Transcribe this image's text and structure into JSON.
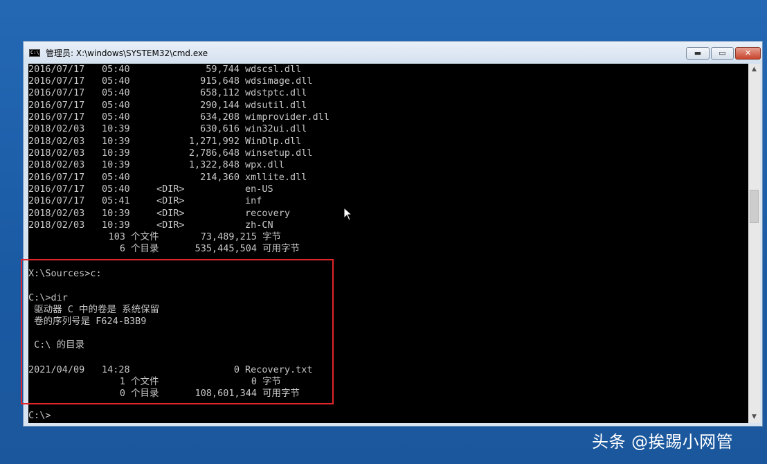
{
  "window": {
    "title": "管理员: X:\\windows\\SYSTEM32\\cmd.exe",
    "icon_label": "C:\\",
    "min_symbol": "▬",
    "max_symbol": "▭",
    "close_symbol": "✕"
  },
  "listing": [
    {
      "date": "2016/07/17",
      "time": "05:40",
      "size": "59,744",
      "name": "wdscsl.dll"
    },
    {
      "date": "2016/07/17",
      "time": "05:40",
      "size": "915,648",
      "name": "wdsimage.dll"
    },
    {
      "date": "2016/07/17",
      "time": "05:40",
      "size": "658,112",
      "name": "wdstptc.dll"
    },
    {
      "date": "2016/07/17",
      "time": "05:40",
      "size": "290,144",
      "name": "wdsutil.dll"
    },
    {
      "date": "2016/07/17",
      "time": "05:40",
      "size": "634,208",
      "name": "wimprovider.dll"
    },
    {
      "date": "2018/02/03",
      "time": "10:39",
      "size": "630,616",
      "name": "win32ui.dll"
    },
    {
      "date": "2018/02/03",
      "time": "10:39",
      "size": "1,271,992",
      "name": "WinDlp.dll"
    },
    {
      "date": "2018/02/03",
      "time": "10:39",
      "size": "2,786,648",
      "name": "winsetup.dll"
    },
    {
      "date": "2018/02/03",
      "time": "10:39",
      "size": "1,322,848",
      "name": "wpx.dll"
    },
    {
      "date": "2016/07/17",
      "time": "05:40",
      "size": "214,360",
      "name": "xmllite.dll"
    },
    {
      "date": "2016/07/17",
      "time": "05:40",
      "dir": "<DIR>",
      "name": "en-US"
    },
    {
      "date": "2016/07/17",
      "time": "05:41",
      "dir": "<DIR>",
      "name": "inf"
    },
    {
      "date": "2018/02/03",
      "time": "10:39",
      "dir": "<DIR>",
      "name": "recovery"
    },
    {
      "date": "2018/02/03",
      "time": "10:39",
      "dir": "<DIR>",
      "name": "zh-CN"
    }
  ],
  "summary1": {
    "files_count": "103",
    "files_label": "个文件",
    "files_bytes": "73,489,215",
    "bytes_label": "字节",
    "dirs_count": "6",
    "dirs_label": "个目录",
    "dirs_free": "535,445,504",
    "free_label": "可用字节"
  },
  "commands": {
    "prompt1": "X:\\Sources>c:",
    "prompt2": "C:\\>dir",
    "volume_line": " 驱动器 C 中的卷是 系统保留",
    "serial_line": " 卷的序列号是 F624-B3B9",
    "dir_of_line": " C:\\ 的目录",
    "prompt3": "C:\\>"
  },
  "file_entry": {
    "date": "2021/04/09",
    "time": "14:28",
    "size": "0",
    "name": "Recovery.txt"
  },
  "summary2": {
    "files_count": "1",
    "files_label": "个文件",
    "files_bytes": "0",
    "bytes_label": "字节",
    "dirs_count": "0",
    "dirs_label": "个目录",
    "dirs_free": "108,601,344",
    "free_label": "可用字节"
  },
  "scrollbar": {
    "up_symbol": "▲",
    "down_symbol": "▼"
  },
  "watermark": "头条 @挨踢小网管",
  "colors": {
    "desktop": "#1f5fa8",
    "console_bg": "#000000",
    "console_text": "#c8c8c8",
    "highlight": "#e0262a"
  }
}
